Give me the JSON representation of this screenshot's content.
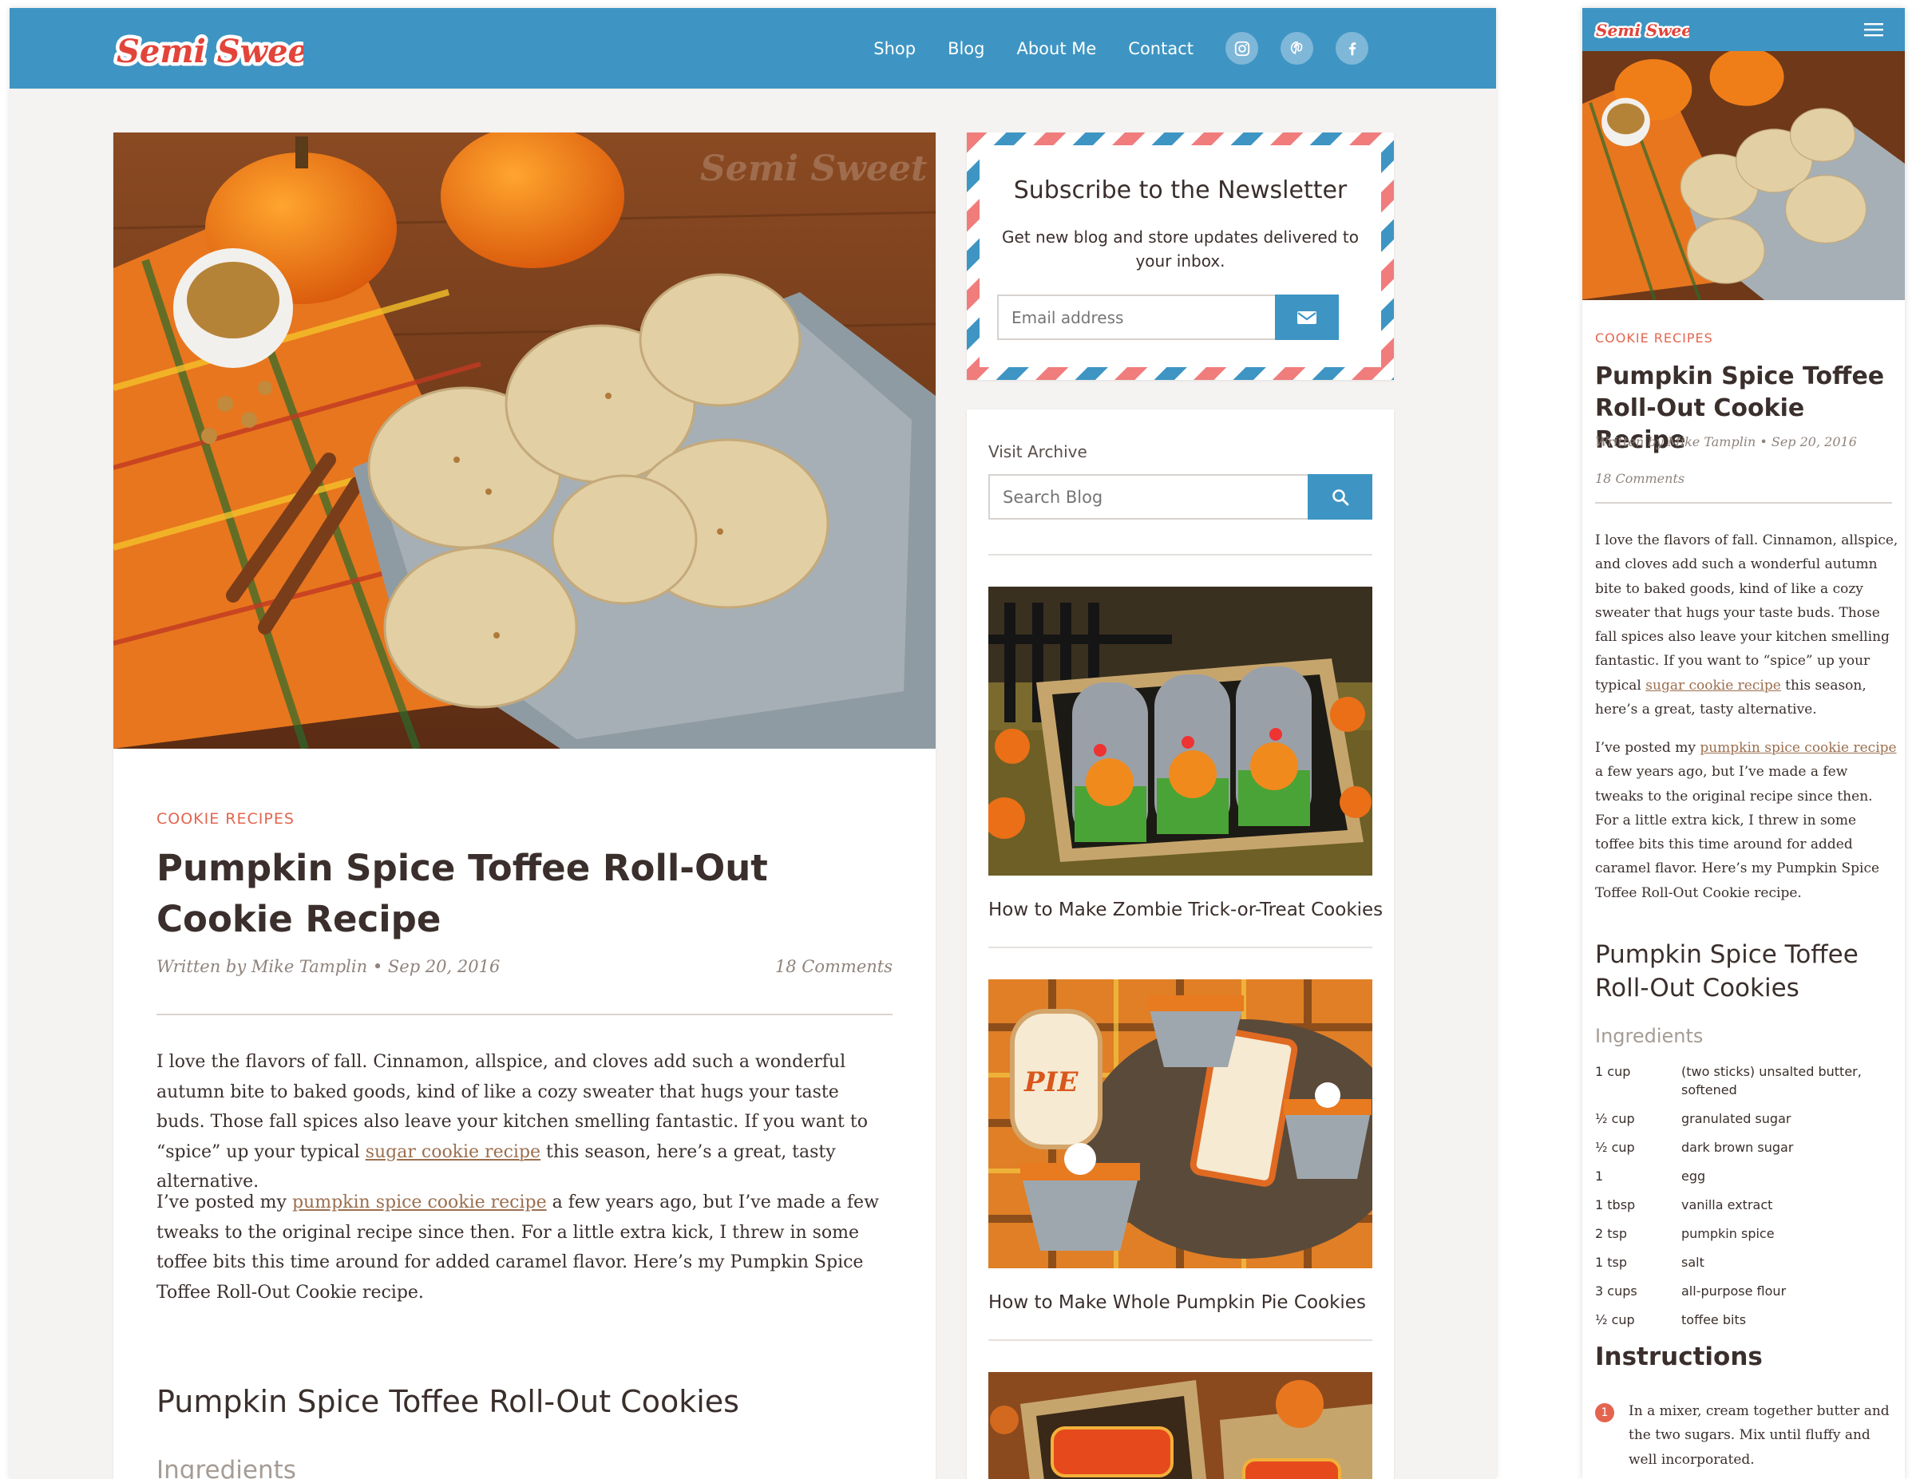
{
  "brand": {
    "logo_text": "Semi Sweet"
  },
  "nav": {
    "items": [
      "Shop",
      "Blog",
      "About Me",
      "Contact"
    ]
  },
  "social": {
    "icons": [
      "instagram-icon",
      "pinterest-icon",
      "facebook-icon"
    ]
  },
  "colors": {
    "header": "#3e95c3",
    "accent": "#e3654f",
    "text": "#3a2f2c",
    "link": "#9b6f4f"
  },
  "article": {
    "category": "COOKIE RECIPES",
    "title": "Pumpkin Spice Toffee Roll-Out Cookie Recipe",
    "byline": "Written by Mike Tamplin • Sep 20, 2016",
    "comments": "18 Comments",
    "p1_a": "I love the flavors of fall. Cinnamon, allspice, and cloves add such a wonderful autumn bite to baked goods, kind of like a cozy sweater that hugs your taste buds. Those fall spices also leave your kitchen smelling fantastic. If you want to “spice” up your typical ",
    "p1_link": "sugar cookie recipe",
    "p1_b": " this season, here’s a great, tasty alternative.",
    "p2_a": "I’ve posted my ",
    "p2_link": "pumpkin spice cookie recipe",
    "p2_b": " a few years ago, but I’ve made a few tweaks to the original recipe since then. For a little extra kick, I threw in some toffee bits this time around for added caramel flavor. Here’s my Pumpkin Spice Toffee Roll-Out Cookie recipe.",
    "recipe_title": "Pumpkin Spice Toffee Roll-Out Cookies",
    "ingredients_label": "Ingredients",
    "ingredients": [
      {
        "qty": "1 cup",
        "item": "(two sticks) unsalted butter, softened"
      },
      {
        "qty": "½ cup",
        "item": "granulated sugar"
      },
      {
        "qty": "½ cup",
        "item": "dark brown sugar"
      },
      {
        "qty": "1",
        "item": "egg"
      },
      {
        "qty": "1 tbsp",
        "item": "vanilla extract"
      },
      {
        "qty": "2 tsp",
        "item": "pumpkin spice"
      },
      {
        "qty": "1 tsp",
        "item": "salt"
      },
      {
        "qty": "3 cups",
        "item": "all-purpose flour"
      },
      {
        "qty": "½ cup",
        "item": "toffee bits"
      }
    ],
    "instructions_label": "Instructions",
    "step1_num": "1",
    "step1": "In a mixer, cream together butter and the two sugars. Mix until fluffy and well incorporated."
  },
  "newsletter": {
    "title": "Subscribe to the Newsletter",
    "text": "Get new blog and store updates delivered to your inbox.",
    "email_placeholder": "Email address"
  },
  "archive": {
    "label": "Visit Archive",
    "search_placeholder": "Search Blog",
    "posts": [
      {
        "title": "How to Make Zombie Trick-or-Treat Cookies"
      },
      {
        "title": "How to Make Whole Pumpkin Pie Cookies"
      }
    ]
  }
}
